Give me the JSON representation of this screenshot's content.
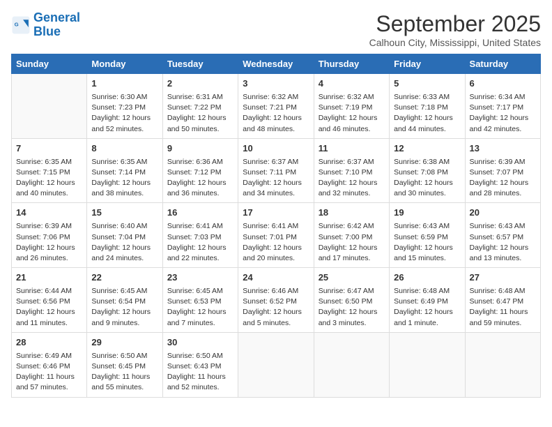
{
  "logo": {
    "line1": "General",
    "line2": "Blue"
  },
  "title": "September 2025",
  "subtitle": "Calhoun City, Mississippi, United States",
  "weekdays": [
    "Sunday",
    "Monday",
    "Tuesday",
    "Wednesday",
    "Thursday",
    "Friday",
    "Saturday"
  ],
  "weeks": [
    [
      {
        "day": "",
        "text": ""
      },
      {
        "day": "1",
        "text": "Sunrise: 6:30 AM\nSunset: 7:23 PM\nDaylight: 12 hours\nand 52 minutes."
      },
      {
        "day": "2",
        "text": "Sunrise: 6:31 AM\nSunset: 7:22 PM\nDaylight: 12 hours\nand 50 minutes."
      },
      {
        "day": "3",
        "text": "Sunrise: 6:32 AM\nSunset: 7:21 PM\nDaylight: 12 hours\nand 48 minutes."
      },
      {
        "day": "4",
        "text": "Sunrise: 6:32 AM\nSunset: 7:19 PM\nDaylight: 12 hours\nand 46 minutes."
      },
      {
        "day": "5",
        "text": "Sunrise: 6:33 AM\nSunset: 7:18 PM\nDaylight: 12 hours\nand 44 minutes."
      },
      {
        "day": "6",
        "text": "Sunrise: 6:34 AM\nSunset: 7:17 PM\nDaylight: 12 hours\nand 42 minutes."
      }
    ],
    [
      {
        "day": "7",
        "text": "Sunrise: 6:35 AM\nSunset: 7:15 PM\nDaylight: 12 hours\nand 40 minutes."
      },
      {
        "day": "8",
        "text": "Sunrise: 6:35 AM\nSunset: 7:14 PM\nDaylight: 12 hours\nand 38 minutes."
      },
      {
        "day": "9",
        "text": "Sunrise: 6:36 AM\nSunset: 7:12 PM\nDaylight: 12 hours\nand 36 minutes."
      },
      {
        "day": "10",
        "text": "Sunrise: 6:37 AM\nSunset: 7:11 PM\nDaylight: 12 hours\nand 34 minutes."
      },
      {
        "day": "11",
        "text": "Sunrise: 6:37 AM\nSunset: 7:10 PM\nDaylight: 12 hours\nand 32 minutes."
      },
      {
        "day": "12",
        "text": "Sunrise: 6:38 AM\nSunset: 7:08 PM\nDaylight: 12 hours\nand 30 minutes."
      },
      {
        "day": "13",
        "text": "Sunrise: 6:39 AM\nSunset: 7:07 PM\nDaylight: 12 hours\nand 28 minutes."
      }
    ],
    [
      {
        "day": "14",
        "text": "Sunrise: 6:39 AM\nSunset: 7:06 PM\nDaylight: 12 hours\nand 26 minutes."
      },
      {
        "day": "15",
        "text": "Sunrise: 6:40 AM\nSunset: 7:04 PM\nDaylight: 12 hours\nand 24 minutes."
      },
      {
        "day": "16",
        "text": "Sunrise: 6:41 AM\nSunset: 7:03 PM\nDaylight: 12 hours\nand 22 minutes."
      },
      {
        "day": "17",
        "text": "Sunrise: 6:41 AM\nSunset: 7:01 PM\nDaylight: 12 hours\nand 20 minutes."
      },
      {
        "day": "18",
        "text": "Sunrise: 6:42 AM\nSunset: 7:00 PM\nDaylight: 12 hours\nand 17 minutes."
      },
      {
        "day": "19",
        "text": "Sunrise: 6:43 AM\nSunset: 6:59 PM\nDaylight: 12 hours\nand 15 minutes."
      },
      {
        "day": "20",
        "text": "Sunrise: 6:43 AM\nSunset: 6:57 PM\nDaylight: 12 hours\nand 13 minutes."
      }
    ],
    [
      {
        "day": "21",
        "text": "Sunrise: 6:44 AM\nSunset: 6:56 PM\nDaylight: 12 hours\nand 11 minutes."
      },
      {
        "day": "22",
        "text": "Sunrise: 6:45 AM\nSunset: 6:54 PM\nDaylight: 12 hours\nand 9 minutes."
      },
      {
        "day": "23",
        "text": "Sunrise: 6:45 AM\nSunset: 6:53 PM\nDaylight: 12 hours\nand 7 minutes."
      },
      {
        "day": "24",
        "text": "Sunrise: 6:46 AM\nSunset: 6:52 PM\nDaylight: 12 hours\nand 5 minutes."
      },
      {
        "day": "25",
        "text": "Sunrise: 6:47 AM\nSunset: 6:50 PM\nDaylight: 12 hours\nand 3 minutes."
      },
      {
        "day": "26",
        "text": "Sunrise: 6:48 AM\nSunset: 6:49 PM\nDaylight: 12 hours\nand 1 minute."
      },
      {
        "day": "27",
        "text": "Sunrise: 6:48 AM\nSunset: 6:47 PM\nDaylight: 11 hours\nand 59 minutes."
      }
    ],
    [
      {
        "day": "28",
        "text": "Sunrise: 6:49 AM\nSunset: 6:46 PM\nDaylight: 11 hours\nand 57 minutes."
      },
      {
        "day": "29",
        "text": "Sunrise: 6:50 AM\nSunset: 6:45 PM\nDaylight: 11 hours\nand 55 minutes."
      },
      {
        "day": "30",
        "text": "Sunrise: 6:50 AM\nSunset: 6:43 PM\nDaylight: 11 hours\nand 52 minutes."
      },
      {
        "day": "",
        "text": ""
      },
      {
        "day": "",
        "text": ""
      },
      {
        "day": "",
        "text": ""
      },
      {
        "day": "",
        "text": ""
      }
    ]
  ]
}
